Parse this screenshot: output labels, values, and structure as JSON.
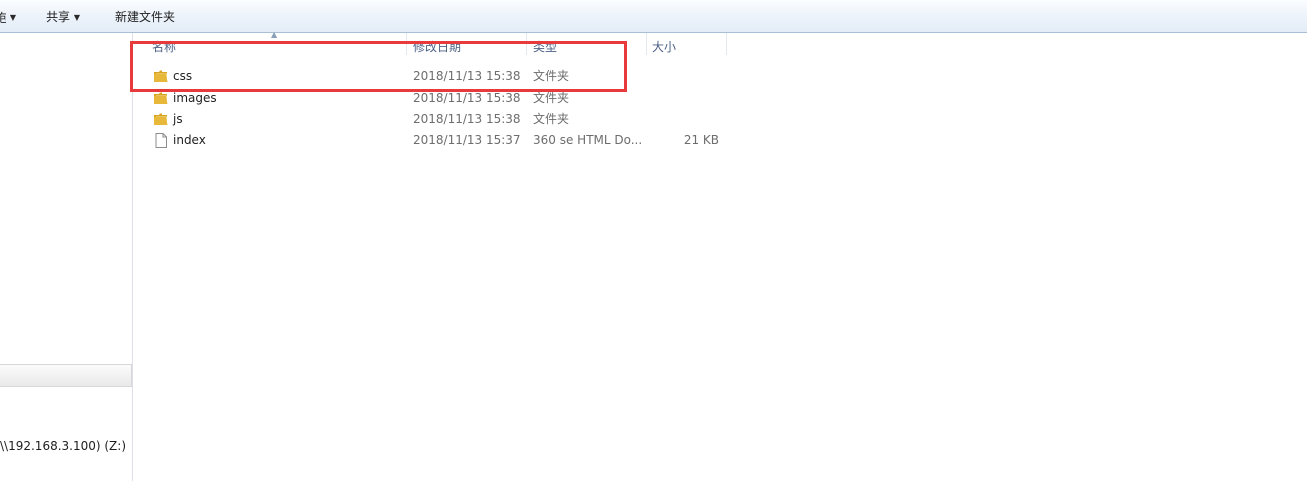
{
  "toolbar": {
    "partial_label": "包",
    "share_label": "共享",
    "new_folder_label": "新建文件夹"
  },
  "columns": {
    "name": "名称",
    "date": "修改日期",
    "type": "类型",
    "size": "大小"
  },
  "files": [
    {
      "name": "css",
      "date": "2018/11/13 15:38",
      "type": "文件夹",
      "size": "",
      "icon": "folder-icon"
    },
    {
      "name": "images",
      "date": "2018/11/13 15:38",
      "type": "文件夹",
      "size": "",
      "icon": "folder-icon"
    },
    {
      "name": "js",
      "date": "2018/11/13 15:38",
      "type": "文件夹",
      "size": "",
      "icon": "folder-icon"
    },
    {
      "name": "index",
      "date": "2018/11/13 15:37",
      "type": "360 se HTML Do...",
      "size": "21 KB",
      "icon": "file-icon"
    }
  ],
  "nav": {
    "drive_label": "\\\\192.168.3.100) (Z:)"
  },
  "colors": {
    "highlight": "#e8393b",
    "header_text": "#4d6185"
  }
}
